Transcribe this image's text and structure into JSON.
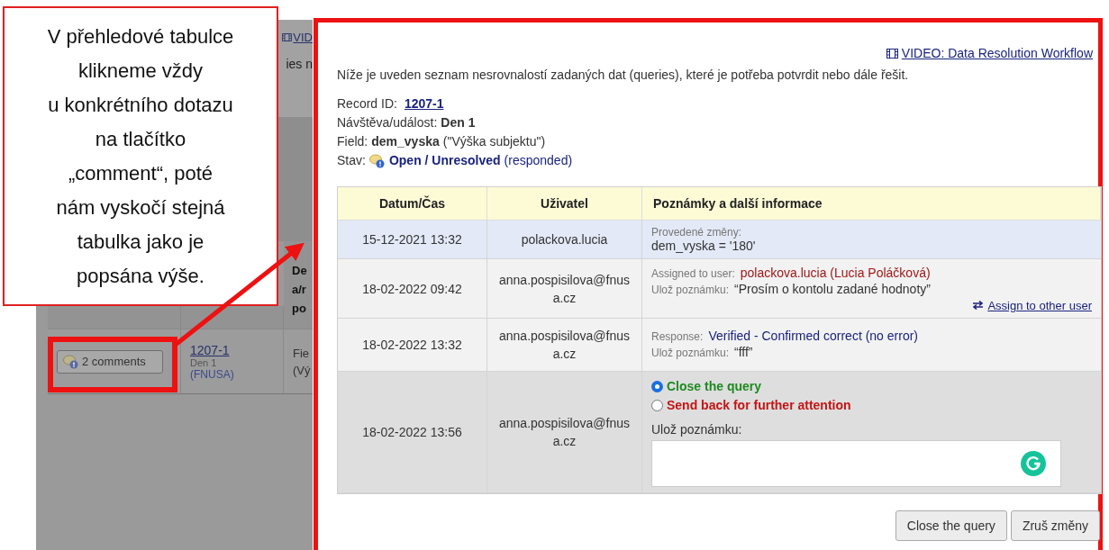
{
  "background_page": {
    "video_link": "VID",
    "intro": "ies n",
    "table": {
      "heading_lines": [
        "De",
        "a/r",
        "po"
      ],
      "row": {
        "comments_button": "2 comments",
        "record": "1207-1",
        "event": "Den 1",
        "group": "(FNUSA)",
        "field_lines": [
          "Fie",
          "(Vý"
        ]
      }
    }
  },
  "callout": {
    "lines": [
      "V přehledové tabulce",
      "klikneme vždy",
      "u konkrétního dotazu",
      "na tlačítko",
      "„comment“, poté",
      "nám vyskočí stejná",
      "tabulka jako je",
      "popsána výše."
    ]
  },
  "dialog": {
    "video_link": "VIDEO: Data Resolution Workflow",
    "intro": "Níže je uveden seznam nesrovnalostí zadaných dat (queries), které je potřeba potvrdit nebo dále řešit.",
    "record_id": {
      "label": "Record ID:",
      "value": "1207-1"
    },
    "event": {
      "label": "Návštěva/událost:",
      "value": "Den 1"
    },
    "field": {
      "label": "Field:",
      "value": "dem_vyska",
      "note": "(\"Výška subjektu\")"
    },
    "status": {
      "label": "Stav:",
      "value": "Open / Unresolved",
      "note": "(responded)"
    },
    "table": {
      "columns": [
        "Datum/Čas",
        "Uživatel",
        "Poznámky a další informace"
      ],
      "rows": [
        {
          "kind": "change",
          "date": "15-12-2021 13:32",
          "user": "polackova.lucia",
          "caption": "Provedené změny:",
          "text": "dem_vyska = '180'"
        },
        {
          "kind": "assign",
          "date": "18-02-2022 09:42",
          "user": "anna.pospisilova@fnusa.cz",
          "assigned_label": "Assigned to user:",
          "assigned": "polackova.lucia (Lucia Poláčková)",
          "note_label": "Ulož poznámku:",
          "note": "“Prosím o kontolu zadané hodnoty”",
          "link": "Assign to other user"
        },
        {
          "kind": "response",
          "date": "18-02-2022 13:32",
          "user": "anna.pospisilova@fnusa.cz",
          "response_label": "Response:",
          "response": "Verified - Confirmed correct (no error)",
          "note_label": "Ulož poznámku:",
          "note": "“fff”"
        },
        {
          "kind": "action",
          "date": "18-02-2022 13:56",
          "user": "anna.pospisilova@fnusa.cz",
          "options": [
            {
              "label": "Close the query",
              "selected": true,
              "color": "#1e8a1e"
            },
            {
              "label": "Send back for further attention",
              "selected": false,
              "color": "#c41414"
            }
          ],
          "note_label": "Ulož poznámku:"
        }
      ]
    },
    "buttons": [
      "Close the query",
      "Zruš změny"
    ]
  }
}
